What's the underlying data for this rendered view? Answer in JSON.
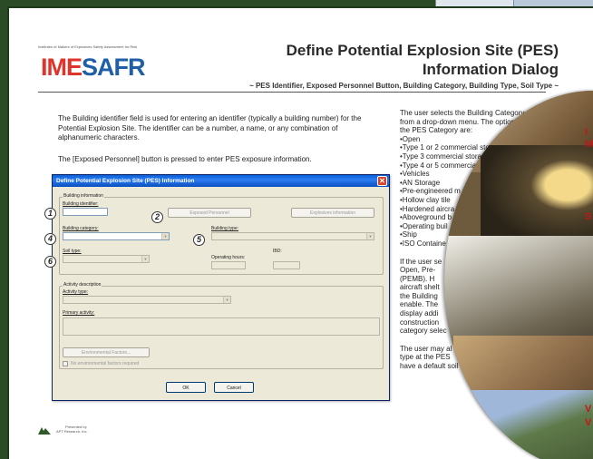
{
  "logo": {
    "tagline": "Institutes of Makers of Explosives Safety Assessment for Risk",
    "ime": "IME",
    "safr": "SAFR"
  },
  "title": {
    "line1": "Define Potential Explosion Site (PES)",
    "line2": "Information Dialog",
    "subtitle": "~ PES Identifier, Exposed Personnel Button, Building Category, Building Type, Soil Type ~"
  },
  "left_text": {
    "para1": "The Building identifier field is used for entering an identifier (typically a building number) for the Potential Explosion Site.  The identifier can be a number, a name, or any combination of alphanumeric characters.",
    "para2": "The [Exposed Personnel] button is pressed to enter PES exposure information."
  },
  "right_text": {
    "lines1": [
      "The user selects the Building Category",
      "from a drop-down menu.  The options fo",
      "the PES Category are:",
      "•Open",
      "•Type 1 or 2 commercial sto",
      "•Type 3 commercial storag",
      "•Type 4 or 5 commercia",
      "•Vehicles",
      "•AN Storage",
      "•Pre-engineered m",
      "•Hollow clay tile",
      "•Hardened aircra",
      "•Aboveground b",
      "•Operating buil",
      "•Ship",
      "•ISO Containe"
    ],
    "lines2": [
      "If the user se",
      "Open,  Pre-",
      "(PEMB).  H",
      "aircraft shelt",
      "the Building",
      "enable.  The",
      "display  addi",
      "construction",
      "category selec"
    ],
    "lines3": [
      "The user may al",
      "type at the PES",
      "have a default soil"
    ]
  },
  "dialog": {
    "title": "Define Potential Explosion Site (PES) Information",
    "close_glyph": "✕",
    "group_building": "Building information",
    "building_identifier_label": "Building identifier:",
    "exposed_personnel_label": "Exposed Personnel",
    "explosives_info_label": "Explosives information",
    "building_category_label": "Building category:",
    "building_type_label": "Building type:",
    "soil_type_label": "Soil type:",
    "operating_hours_label": "Operating hours:",
    "iod_label": "IBD:",
    "group_activity": "Activity description",
    "activity_type_label": "Activity type:",
    "primary_activity_label": "Primary activity:",
    "environmental_factors_label": "Environmental Factors...",
    "no_env_factors_label": "No environmental factors required",
    "ok_label": "OK",
    "cancel_label": "Cancel",
    "dropdown_glyph": "▼"
  },
  "markers": [
    "1",
    "2",
    "4",
    "5",
    "6"
  ],
  "collage_text": {
    "top": "I",
    "top2": "M",
    "mid": "S",
    "bottom1": "V",
    "bottom2": "V"
  },
  "footer": {
    "line1": "Presented by",
    "line2": "APT Research, Inc."
  }
}
